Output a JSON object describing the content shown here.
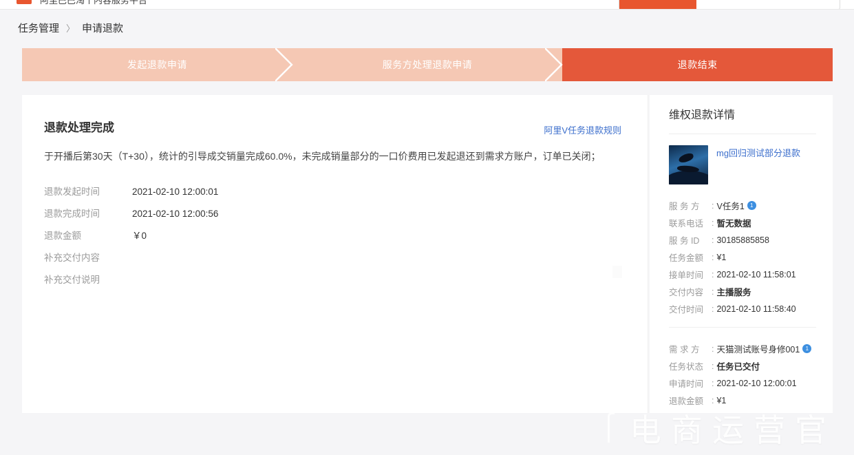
{
  "topbar": {
    "title": "阿里巴巴淘个内容服务平台",
    "logo_icon": "alibaba-logo-icon",
    "search_placeholder": ""
  },
  "breadcrumb": {
    "items": [
      {
        "label": "任务管理",
        "link": true
      },
      {
        "label": "申请退款",
        "link": false
      }
    ],
    "separator": "〉"
  },
  "stepper": {
    "steps": [
      {
        "label": "发起退款申请",
        "active": false
      },
      {
        "label": "服务方处理退款申请",
        "active": false
      },
      {
        "label": "退款结束",
        "active": true
      }
    ],
    "active_color": "#e4583a",
    "inactive_color": "#f5c8b4"
  },
  "left_panel": {
    "title": "退款处理完成",
    "rule_link": "阿里V任务退款规则",
    "description": "于开播后第30天（T+30），统计的引导成交销量完成60.0%，未完成销量部分的一口价费用已发起退还到需求方账户，订单已关闭；",
    "rows": [
      {
        "key": "退款发起时间",
        "value": "2021-02-10 12:00:01"
      },
      {
        "key": "退款完成时间",
        "value": "2021-02-10 12:00:56"
      },
      {
        "key": "退款金额",
        "value": "￥0"
      },
      {
        "key": "补充交付内容",
        "value": ""
      },
      {
        "key": "补充交付说明",
        "value": ""
      }
    ]
  },
  "right_panel": {
    "title": "维权退款详情",
    "product": {
      "name": "mg回归测试部分退款",
      "thumb_icon": "dolphin-thumbnail-icon"
    },
    "provider": [
      {
        "key": "服 务 方",
        "value": "V任务1",
        "badge": "1",
        "bold": false
      },
      {
        "key": "联系电话",
        "value": "暂无数据",
        "badge": "",
        "bold": true
      },
      {
        "key": "服 务 ID",
        "value": "30185885858",
        "badge": "",
        "bold": false
      },
      {
        "key": "任务金额",
        "value": "¥1",
        "badge": "",
        "bold": false
      },
      {
        "key": "接单时间",
        "value": "2021-02-10 11:58:01",
        "badge": "",
        "bold": false
      },
      {
        "key": "交付内容",
        "value": "主播服务",
        "badge": "",
        "bold": true
      },
      {
        "key": "交付时间",
        "value": "2021-02-10 11:58:40",
        "badge": "",
        "bold": false
      }
    ],
    "demander": [
      {
        "key": "需 求 方",
        "value": "天猫测试账号身修001",
        "badge": "1",
        "bold": false
      },
      {
        "key": "任务状态",
        "value": "任务已交付",
        "badge": "",
        "bold": true
      },
      {
        "key": "申请时间",
        "value": "2021-02-10 12:00:01",
        "badge": "",
        "bold": false
      },
      {
        "key": "退款金额",
        "value": "¥1",
        "badge": "",
        "bold": false
      }
    ]
  },
  "watermark": {
    "text": "电商运营官"
  }
}
